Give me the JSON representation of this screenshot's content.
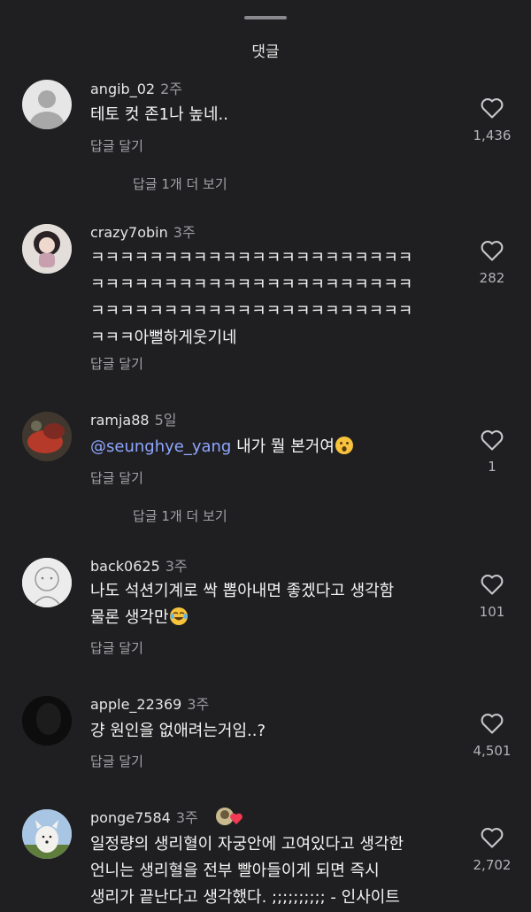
{
  "header": {
    "title": "댓글"
  },
  "reply_label": "답글 달기",
  "comments": [
    {
      "username": "angib_02",
      "time": "2주",
      "lines": [
        "테토 컷 존1나 높네.."
      ],
      "likes": "1,436",
      "more": "답글 1개 더 보기"
    },
    {
      "username": "crazy7obin",
      "time": "3주",
      "lines": [
        "ㅋㅋㅋㅋㅋㅋㅋㅋㅋㅋㅋㅋㅋㅋㅋㅋㅋㅋㅋㅋㅋㅋ",
        "ㅋㅋㅋㅋㅋㅋㅋㅋㅋㅋㅋㅋㅋㅋㅋㅋㅋㅋㅋㅋㅋㅋ",
        "ㅋㅋㅋㅋㅋㅋㅋㅋㅋㅋㅋㅋㅋㅋㅋㅋㅋㅋㅋㅋㅋㅋ",
        "ㅋㅋㅋ아뻘하게웃기네"
      ],
      "likes": "282"
    },
    {
      "username": "ramja88",
      "time": "5일",
      "mention": "@seunghye_yang",
      "text": " 내가 뭘 본거여",
      "likes": "1",
      "more": "답글 1개 더 보기",
      "emoji": "surprised-face-emoji"
    },
    {
      "username": "back0625",
      "time": "3주",
      "lines": [
        "나도 석션기계로 싹 뽑아내면 좋겠다고 생각함",
        "물론 생각만"
      ],
      "likes": "101",
      "emoji": "tears-of-joy-emoji"
    },
    {
      "username": "apple_22369",
      "time": "3주",
      "lines": [
        "걍 원인을 없애려는거임..?"
      ],
      "likes": "4,501"
    },
    {
      "username": "ponge7584",
      "time": "3주",
      "lines": [
        "일정량의 생리혈이 자궁안에 고여있다고 생각한",
        "언니는 생리혈을 전부 빨아들이게 되면 즉시",
        "생리가 끝난다고 생각했다. ;;;;;;;;;; - 인사이트"
      ],
      "likes": "2,702",
      "badge": "creator-liked-heart-badge"
    }
  ],
  "colors": {
    "background": "#1f1f21",
    "mention": "#8fa6ff",
    "secondary": "#a3a3a8"
  }
}
